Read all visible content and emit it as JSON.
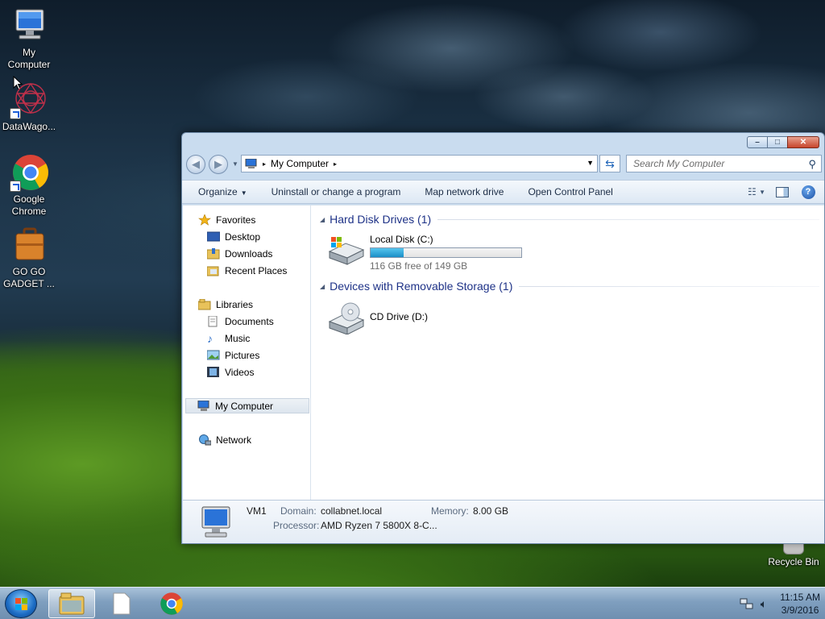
{
  "desktop": {
    "icons": [
      {
        "label": "My\nComputer",
        "icon": "computer-icon"
      },
      {
        "label": "DataWago...",
        "icon": "datawagon-icon"
      },
      {
        "label": "Google\nChrome",
        "icon": "chrome-icon"
      },
      {
        "label": "GO GO\nGADGET ...",
        "icon": "briefcase-icon"
      },
      {
        "label": "Recycle Bin",
        "icon": "recycle-bin-icon"
      }
    ]
  },
  "window": {
    "title_buttons": {
      "minimize": "–",
      "maximize": "□",
      "close": "✕"
    },
    "address": {
      "crumb": "My Computer",
      "separator": "▸"
    },
    "search": {
      "placeholder": "Search My Computer"
    },
    "toolbar": {
      "organize": "Organize",
      "uninstall": "Uninstall or change a program",
      "map_drive": "Map network drive",
      "control_panel": "Open Control Panel",
      "help": "?"
    },
    "nav": {
      "favorites": "Favorites",
      "desktop": "Desktop",
      "downloads": "Downloads",
      "recent": "Recent Places",
      "libraries": "Libraries",
      "documents": "Documents",
      "music": "Music",
      "pictures": "Pictures",
      "videos": "Videos",
      "computer": "My Computer",
      "network": "Network"
    },
    "groups": {
      "hdd": "Hard Disk Drives (1)",
      "removable": "Devices with Removable Storage (1)"
    },
    "drives": {
      "c": {
        "name": "Local Disk (C:)",
        "free": "116 GB free of 149 GB",
        "used_fraction": 0.221
      },
      "d": {
        "name": "CD Drive (D:)"
      }
    },
    "details": {
      "name": "VM1",
      "domain_label": "Domain:",
      "domain": "collabnet.local",
      "memory_label": "Memory:",
      "memory": "8.00 GB",
      "processor_label": "Processor:",
      "processor": "AMD Ryzen 7 5800X 8-C..."
    }
  },
  "taskbar": {
    "time": "11:15 AM",
    "date": "3/9/2016"
  },
  "colors": {
    "accent": "#1e3287",
    "usage_fill": "#1b8fc7"
  }
}
